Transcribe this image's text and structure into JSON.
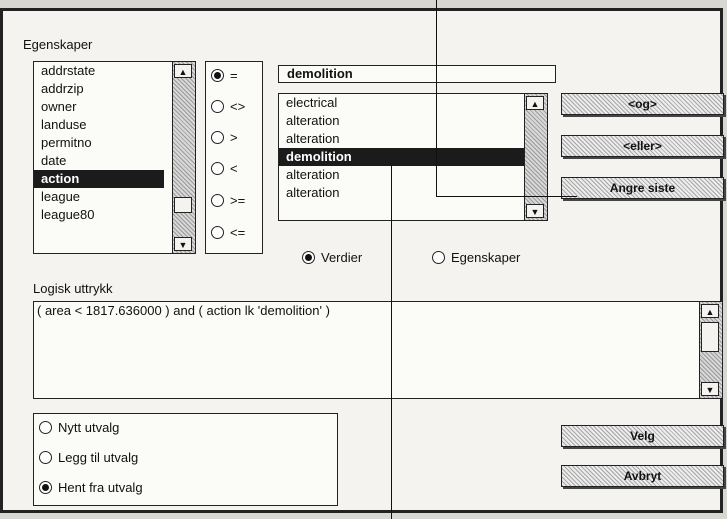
{
  "properties_label": "Egenskaper",
  "properties_list": [
    "addrstate",
    "addrzip",
    "owner",
    "landuse",
    "permitno",
    "date",
    "action",
    "league",
    "league80"
  ],
  "operators": [
    "=",
    "<>",
    ">",
    "<",
    ">=",
    "<="
  ],
  "value_input": "demolition",
  "values_list": [
    "electrical",
    "alteration",
    "alteration",
    "demolition",
    "alteration",
    "alteration"
  ],
  "buttons": {
    "og": "<og>",
    "eller": "<eller>",
    "angre": "Angre siste",
    "velg": "Velg",
    "avbryt": "Avbryt"
  },
  "mode": {
    "verdier": "Verdier",
    "egenskaper": "Egenskaper"
  },
  "logic_label": "Logisk uttrykk",
  "logic_expression": "( area < 1817.636000 ) and ( action lk 'demolition' )",
  "selection_options": [
    "Nytt utvalg",
    "Legg til utvalg",
    "Hent fra utvalg"
  ]
}
